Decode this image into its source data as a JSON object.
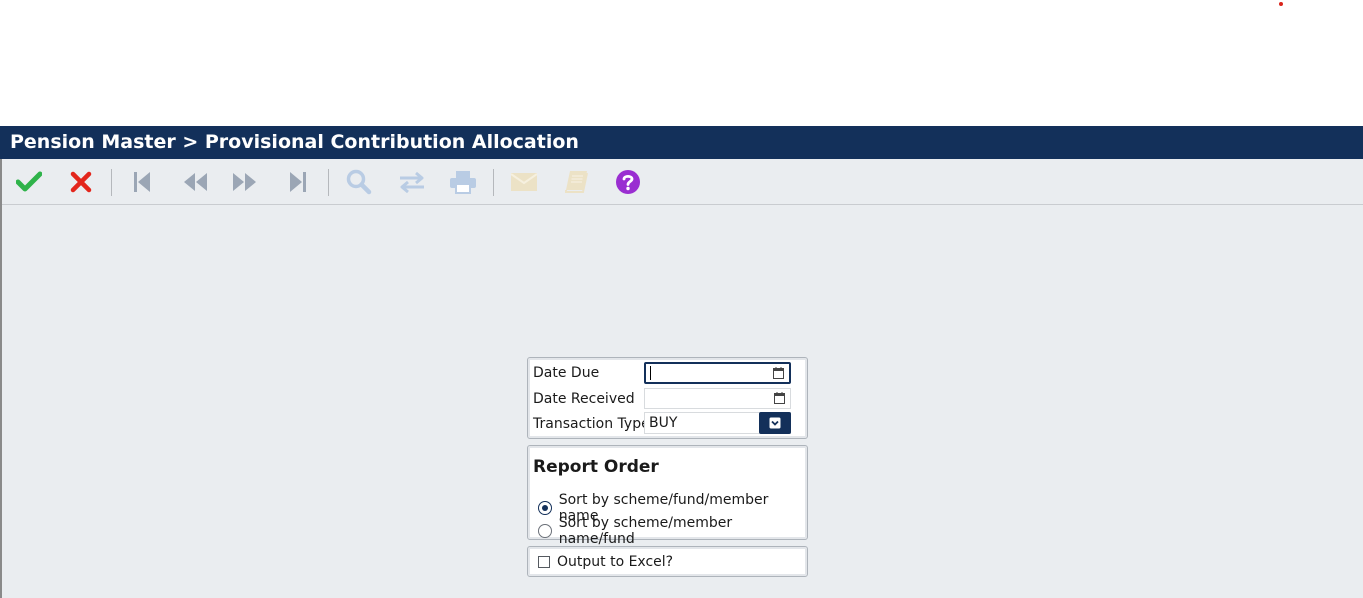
{
  "title": "Pension Master > Provisional Contribution Allocation",
  "toolbar": {
    "buttons": [
      {
        "name": "confirm",
        "icon": "check-icon",
        "color": "#2fb34a"
      },
      {
        "name": "cancel",
        "icon": "close-icon",
        "color": "#e3261c"
      },
      {
        "name": "first",
        "icon": "first-record-icon",
        "color": "#9ba6b5"
      },
      {
        "name": "previous",
        "icon": "previous-record-icon",
        "color": "#9ba6b5"
      },
      {
        "name": "next",
        "icon": "next-record-icon",
        "color": "#9ba6b5"
      },
      {
        "name": "last",
        "icon": "last-record-icon",
        "color": "#9ba6b5"
      },
      {
        "name": "search",
        "icon": "search-icon",
        "color": "#b9cce4"
      },
      {
        "name": "swap",
        "icon": "swap-icon",
        "color": "#b9cce4"
      },
      {
        "name": "print",
        "icon": "print-icon",
        "color": "#b9cce4"
      },
      {
        "name": "email",
        "icon": "envelope-icon",
        "color": "#ece2c6"
      },
      {
        "name": "book",
        "icon": "book-icon",
        "color": "#ece2c6"
      },
      {
        "name": "help",
        "icon": "help-icon",
        "color": "#9a2ed1"
      }
    ]
  },
  "form": {
    "date_due_label": "Date Due",
    "date_due_value": "",
    "date_received_label": "Date Received",
    "date_received_value": "",
    "transaction_type_label": "Transaction Type",
    "transaction_type_value": "BUY"
  },
  "report_order": {
    "title": "Report Order",
    "options": [
      {
        "label": "Sort by scheme/fund/member name",
        "selected": true
      },
      {
        "label": "Sort by scheme/member name/fund",
        "selected": false
      }
    ]
  },
  "excel": {
    "label": "Output to Excel?",
    "checked": false
  },
  "colors": {
    "header_bg": "#13305a",
    "panel_bg": "#eaedf0"
  }
}
